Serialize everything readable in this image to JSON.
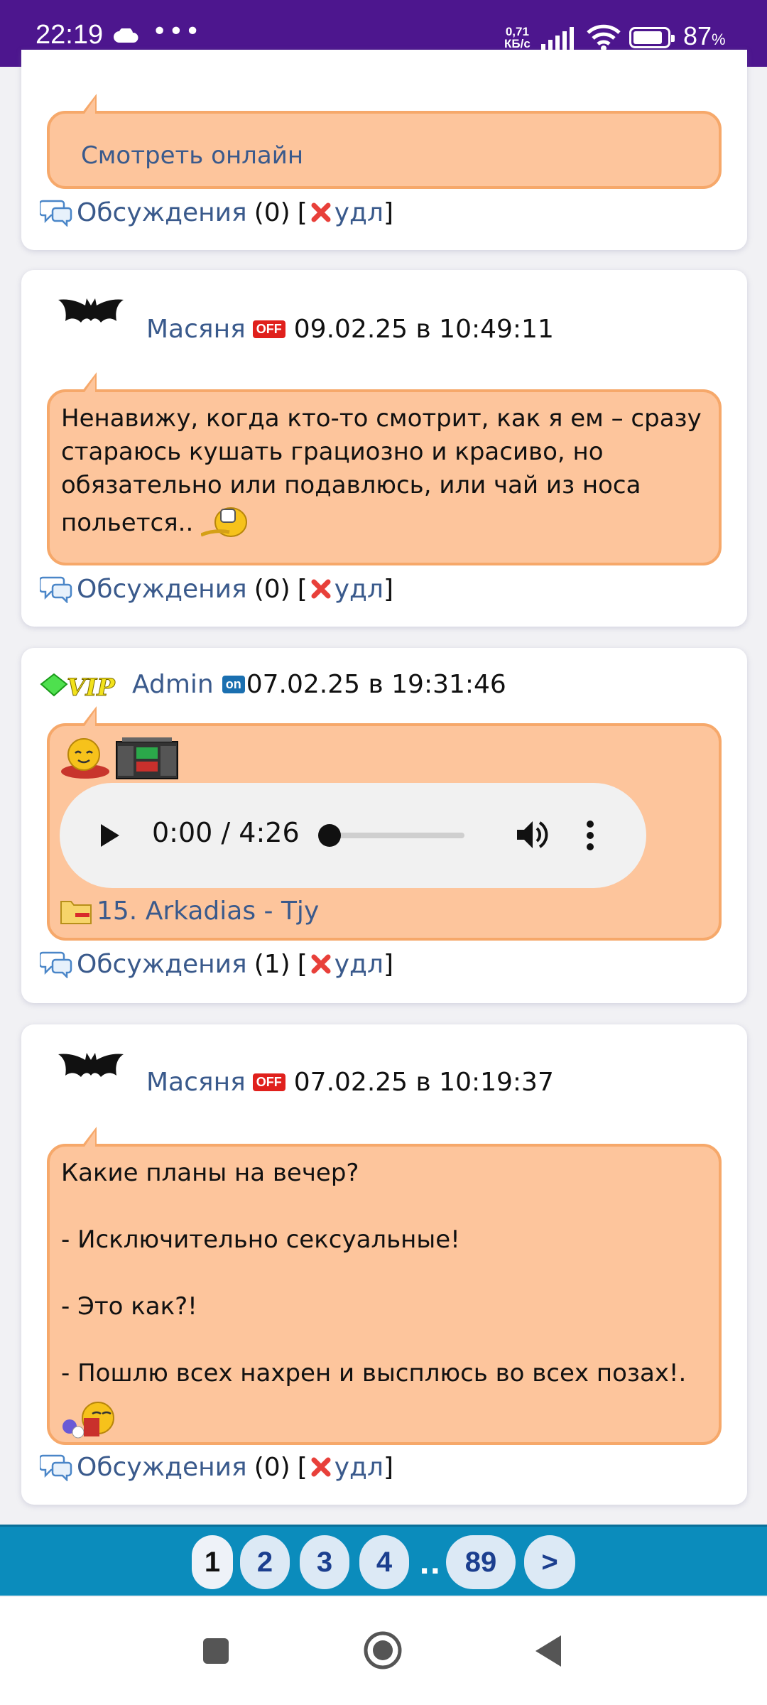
{
  "status_bar": {
    "time": "22:19",
    "dots": "•••",
    "speed_value": "0,71",
    "speed_unit": "КБ/с",
    "battery_value": "87",
    "battery_unit": "%",
    "battery_level": 0.87
  },
  "posts": [
    {
      "message": "Смотреть онлайн",
      "discuss_label": "Обсуждения",
      "discuss_count": "(0)",
      "delete_label": "удл"
    },
    {
      "author": "Масяня",
      "status_badge": "OFF",
      "date": "09.02.25 в 10:49:11",
      "message": "Ненавижу, когда кто-то смотрит, как я ем – сразу стараюсь кушать грациозно и красиво, но обязательно или подавлюсь, или чай из носа польется..",
      "discuss_label": "Обсуждения",
      "discuss_count": "(0)",
      "delete_label": "удл"
    },
    {
      "author": "Admin",
      "vip_badge": "VIP",
      "status_badge": "on",
      "date": "07.02.25 в 19:31:46",
      "audio_time": "0:00 / 4:26",
      "audio_progress": 0,
      "file_name": "15. Arkadias - Tjy",
      "discuss_label": "Обсуждения",
      "discuss_count": "(1)",
      "delete_label": "удл"
    },
    {
      "author": "Масяня",
      "status_badge": "OFF",
      "date": "07.02.25 в 10:19:37",
      "message": "Какие планы на вечер?\n\n- Исключительно сексуальные!\n\n- Это как?!\n\n- Пошлю всех нахрен и высплюсь во всех позах!.",
      "discuss_label": "Обсуждения",
      "discuss_count": "(0)",
      "delete_label": "удл"
    }
  ],
  "pagination": {
    "pages": [
      "1",
      "2",
      "3",
      "4"
    ],
    "separator": "..",
    "last_page": "89",
    "next": ">"
  },
  "colors": {
    "status_bar": "#4d168e",
    "bubble": "#fdc59c",
    "bubble_border": "#f6a86a",
    "link": "#3a5a8c",
    "pager_bar": "#0b8cbc"
  }
}
